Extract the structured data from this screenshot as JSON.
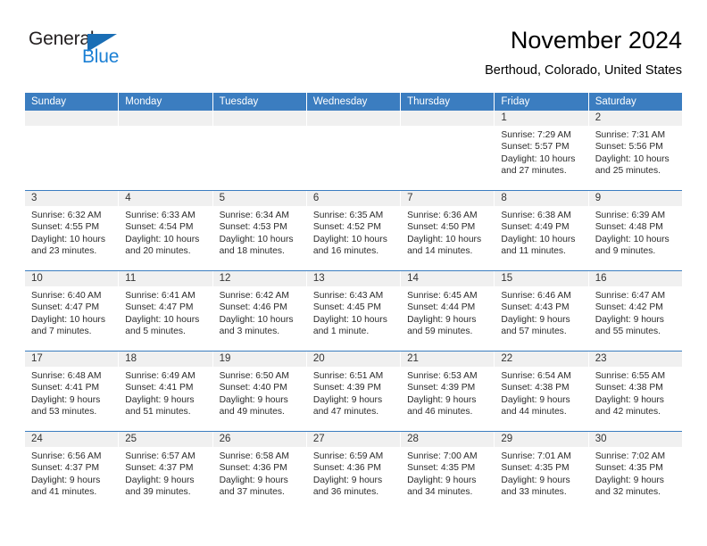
{
  "brand": {
    "name_part1": "General",
    "name_part2": "Blue",
    "triangle_color": "#1a6eb5",
    "blue_text_color": "#1a7fd4",
    "dark_text_color": "#231f20"
  },
  "header": {
    "month_title": "November 2024",
    "location": "Berthoud, Colorado, United States"
  },
  "theme": {
    "header_bar_color": "#3b7dc0",
    "daynum_band_color": "#f0f0f0",
    "row_separator_color": "#3b7dc0",
    "text_color": "#2b2b2b"
  },
  "calendar": {
    "weekday_headers": [
      "Sunday",
      "Monday",
      "Tuesday",
      "Wednesday",
      "Thursday",
      "Friday",
      "Saturday"
    ],
    "weeks": [
      [
        {
          "day": "",
          "empty": true
        },
        {
          "day": "",
          "empty": true
        },
        {
          "day": "",
          "empty": true
        },
        {
          "day": "",
          "empty": true
        },
        {
          "day": "",
          "empty": true
        },
        {
          "day": "1",
          "sunrise": "Sunrise: 7:29 AM",
          "sunset": "Sunset: 5:57 PM",
          "daylight_1": "Daylight: 10 hours",
          "daylight_2": "and 27 minutes."
        },
        {
          "day": "2",
          "sunrise": "Sunrise: 7:31 AM",
          "sunset": "Sunset: 5:56 PM",
          "daylight_1": "Daylight: 10 hours",
          "daylight_2": "and 25 minutes."
        }
      ],
      [
        {
          "day": "3",
          "sunrise": "Sunrise: 6:32 AM",
          "sunset": "Sunset: 4:55 PM",
          "daylight_1": "Daylight: 10 hours",
          "daylight_2": "and 23 minutes."
        },
        {
          "day": "4",
          "sunrise": "Sunrise: 6:33 AM",
          "sunset": "Sunset: 4:54 PM",
          "daylight_1": "Daylight: 10 hours",
          "daylight_2": "and 20 minutes."
        },
        {
          "day": "5",
          "sunrise": "Sunrise: 6:34 AM",
          "sunset": "Sunset: 4:53 PM",
          "daylight_1": "Daylight: 10 hours",
          "daylight_2": "and 18 minutes."
        },
        {
          "day": "6",
          "sunrise": "Sunrise: 6:35 AM",
          "sunset": "Sunset: 4:52 PM",
          "daylight_1": "Daylight: 10 hours",
          "daylight_2": "and 16 minutes."
        },
        {
          "day": "7",
          "sunrise": "Sunrise: 6:36 AM",
          "sunset": "Sunset: 4:50 PM",
          "daylight_1": "Daylight: 10 hours",
          "daylight_2": "and 14 minutes."
        },
        {
          "day": "8",
          "sunrise": "Sunrise: 6:38 AM",
          "sunset": "Sunset: 4:49 PM",
          "daylight_1": "Daylight: 10 hours",
          "daylight_2": "and 11 minutes."
        },
        {
          "day": "9",
          "sunrise": "Sunrise: 6:39 AM",
          "sunset": "Sunset: 4:48 PM",
          "daylight_1": "Daylight: 10 hours",
          "daylight_2": "and 9 minutes."
        }
      ],
      [
        {
          "day": "10",
          "sunrise": "Sunrise: 6:40 AM",
          "sunset": "Sunset: 4:47 PM",
          "daylight_1": "Daylight: 10 hours",
          "daylight_2": "and 7 minutes."
        },
        {
          "day": "11",
          "sunrise": "Sunrise: 6:41 AM",
          "sunset": "Sunset: 4:47 PM",
          "daylight_1": "Daylight: 10 hours",
          "daylight_2": "and 5 minutes."
        },
        {
          "day": "12",
          "sunrise": "Sunrise: 6:42 AM",
          "sunset": "Sunset: 4:46 PM",
          "daylight_1": "Daylight: 10 hours",
          "daylight_2": "and 3 minutes."
        },
        {
          "day": "13",
          "sunrise": "Sunrise: 6:43 AM",
          "sunset": "Sunset: 4:45 PM",
          "daylight_1": "Daylight: 10 hours",
          "daylight_2": "and 1 minute."
        },
        {
          "day": "14",
          "sunrise": "Sunrise: 6:45 AM",
          "sunset": "Sunset: 4:44 PM",
          "daylight_1": "Daylight: 9 hours",
          "daylight_2": "and 59 minutes."
        },
        {
          "day": "15",
          "sunrise": "Sunrise: 6:46 AM",
          "sunset": "Sunset: 4:43 PM",
          "daylight_1": "Daylight: 9 hours",
          "daylight_2": "and 57 minutes."
        },
        {
          "day": "16",
          "sunrise": "Sunrise: 6:47 AM",
          "sunset": "Sunset: 4:42 PM",
          "daylight_1": "Daylight: 9 hours",
          "daylight_2": "and 55 minutes."
        }
      ],
      [
        {
          "day": "17",
          "sunrise": "Sunrise: 6:48 AM",
          "sunset": "Sunset: 4:41 PM",
          "daylight_1": "Daylight: 9 hours",
          "daylight_2": "and 53 minutes."
        },
        {
          "day": "18",
          "sunrise": "Sunrise: 6:49 AM",
          "sunset": "Sunset: 4:41 PM",
          "daylight_1": "Daylight: 9 hours",
          "daylight_2": "and 51 minutes."
        },
        {
          "day": "19",
          "sunrise": "Sunrise: 6:50 AM",
          "sunset": "Sunset: 4:40 PM",
          "daylight_1": "Daylight: 9 hours",
          "daylight_2": "and 49 minutes."
        },
        {
          "day": "20",
          "sunrise": "Sunrise: 6:51 AM",
          "sunset": "Sunset: 4:39 PM",
          "daylight_1": "Daylight: 9 hours",
          "daylight_2": "and 47 minutes."
        },
        {
          "day": "21",
          "sunrise": "Sunrise: 6:53 AM",
          "sunset": "Sunset: 4:39 PM",
          "daylight_1": "Daylight: 9 hours",
          "daylight_2": "and 46 minutes."
        },
        {
          "day": "22",
          "sunrise": "Sunrise: 6:54 AM",
          "sunset": "Sunset: 4:38 PM",
          "daylight_1": "Daylight: 9 hours",
          "daylight_2": "and 44 minutes."
        },
        {
          "day": "23",
          "sunrise": "Sunrise: 6:55 AM",
          "sunset": "Sunset: 4:38 PM",
          "daylight_1": "Daylight: 9 hours",
          "daylight_2": "and 42 minutes."
        }
      ],
      [
        {
          "day": "24",
          "sunrise": "Sunrise: 6:56 AM",
          "sunset": "Sunset: 4:37 PM",
          "daylight_1": "Daylight: 9 hours",
          "daylight_2": "and 41 minutes."
        },
        {
          "day": "25",
          "sunrise": "Sunrise: 6:57 AM",
          "sunset": "Sunset: 4:37 PM",
          "daylight_1": "Daylight: 9 hours",
          "daylight_2": "and 39 minutes."
        },
        {
          "day": "26",
          "sunrise": "Sunrise: 6:58 AM",
          "sunset": "Sunset: 4:36 PM",
          "daylight_1": "Daylight: 9 hours",
          "daylight_2": "and 37 minutes."
        },
        {
          "day": "27",
          "sunrise": "Sunrise: 6:59 AM",
          "sunset": "Sunset: 4:36 PM",
          "daylight_1": "Daylight: 9 hours",
          "daylight_2": "and 36 minutes."
        },
        {
          "day": "28",
          "sunrise": "Sunrise: 7:00 AM",
          "sunset": "Sunset: 4:35 PM",
          "daylight_1": "Daylight: 9 hours",
          "daylight_2": "and 34 minutes."
        },
        {
          "day": "29",
          "sunrise": "Sunrise: 7:01 AM",
          "sunset": "Sunset: 4:35 PM",
          "daylight_1": "Daylight: 9 hours",
          "daylight_2": "and 33 minutes."
        },
        {
          "day": "30",
          "sunrise": "Sunrise: 7:02 AM",
          "sunset": "Sunset: 4:35 PM",
          "daylight_1": "Daylight: 9 hours",
          "daylight_2": "and 32 minutes."
        }
      ]
    ]
  }
}
